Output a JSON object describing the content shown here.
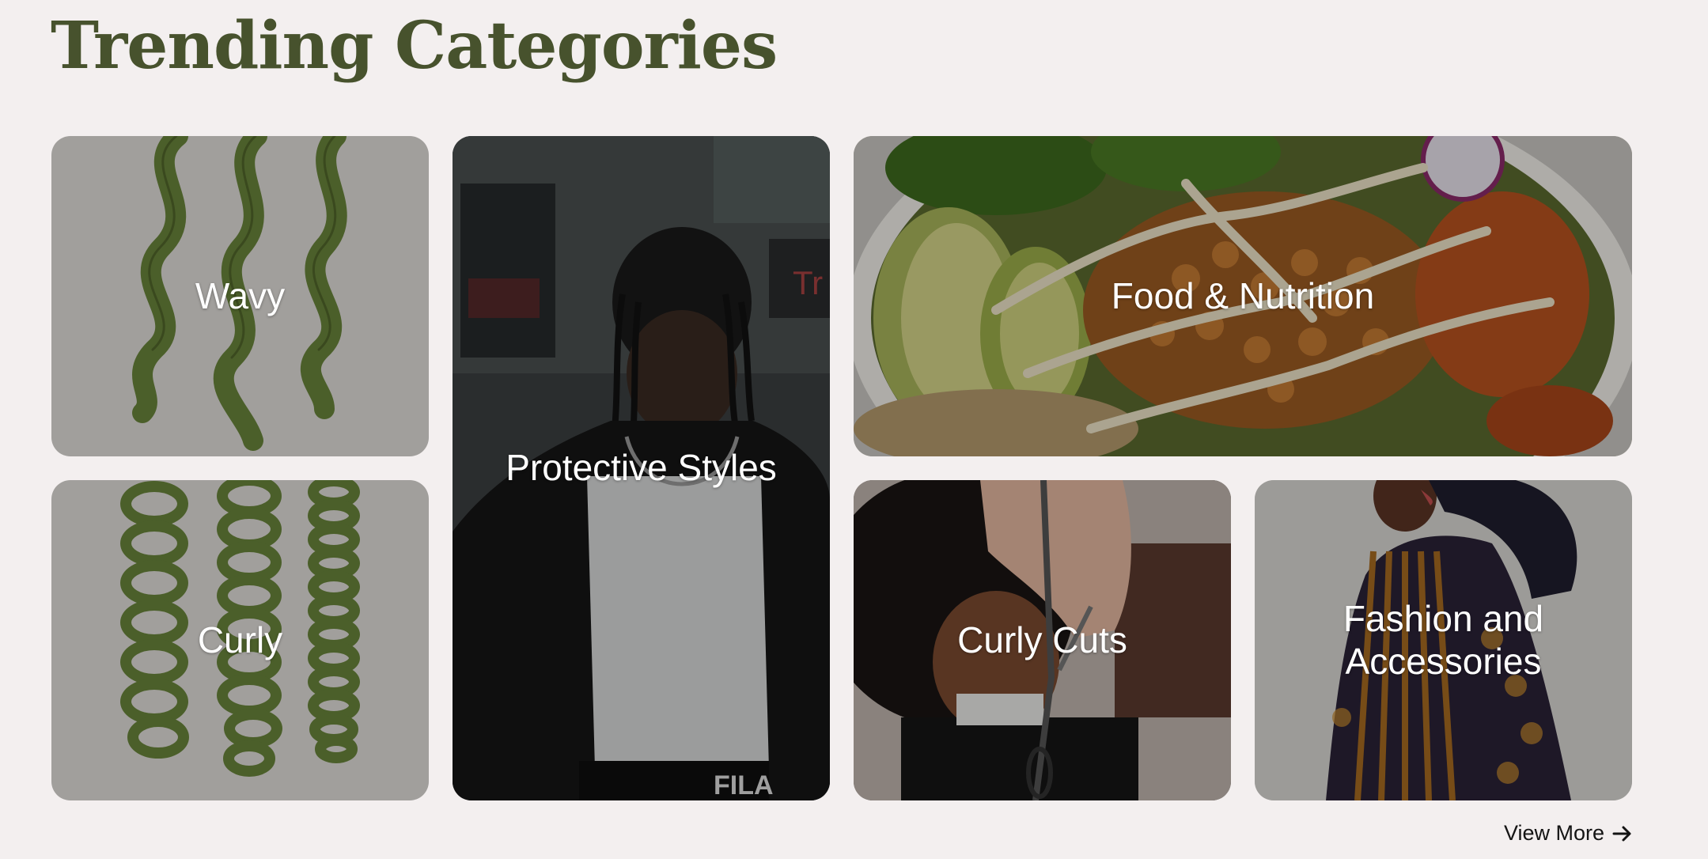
{
  "page": {
    "title": "Trending Categories"
  },
  "categories": {
    "wavy": {
      "label": "Wavy"
    },
    "curly": {
      "label": "Curly"
    },
    "protective": {
      "label": "Protective Styles"
    },
    "food": {
      "label": "Food & Nutrition"
    },
    "cuts": {
      "label": "Curly Cuts"
    },
    "fashion": {
      "label": "Fashion and\nAccessories"
    }
  },
  "footer": {
    "view_more": "View More",
    "arrow_icon": "arrow-right-icon"
  },
  "colors": {
    "accent": "#47522d",
    "tile_gray": "#a19f9c",
    "background": "#f3efef"
  }
}
